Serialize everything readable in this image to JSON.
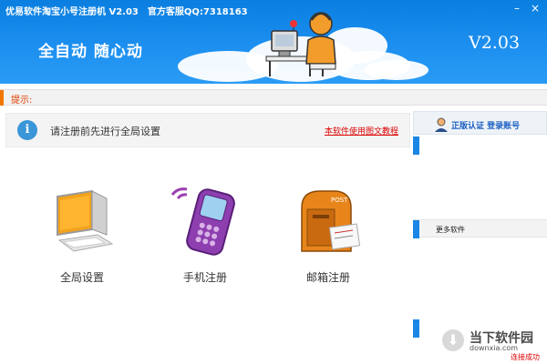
{
  "window": {
    "title": "优易软件淘宝小号注册机 V2.03",
    "service_qq": "官方客服QQ:7318163",
    "minimize_glyph": "–",
    "close_glyph": "×"
  },
  "banner": {
    "slogan": "全自动 随心动",
    "version": "V2.03"
  },
  "hint": {
    "label": "提示:"
  },
  "info": {
    "message": "请注册前先进行全局设置",
    "tutorial_link": "本软件使用图文教程"
  },
  "tiles": [
    {
      "label": "全局设置",
      "icon": "computer-icon"
    },
    {
      "label": "手机注册",
      "icon": "mobile-phone-icon"
    },
    {
      "label": "邮箱注册",
      "icon": "mailbox-icon"
    }
  ],
  "side": {
    "cert_label": "正版认证 登录账号",
    "more_label": "更多软件"
  },
  "watermark": {
    "name": "当下软件园",
    "domain": "downxia.com"
  },
  "status": "连接成功",
  "colors": {
    "banner": "#1c8ff0",
    "accent": "#f07800",
    "side_bar": "#1b86e6",
    "link": "#dd0000"
  }
}
